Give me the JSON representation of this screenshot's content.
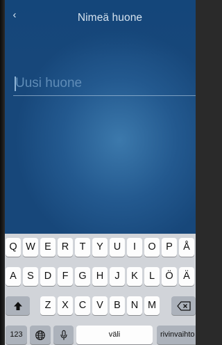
{
  "nav": {
    "back_icon": "chevron-left-icon",
    "back_glyph": "‹",
    "title": "Nimeä huone"
  },
  "room_name": {
    "value": "",
    "placeholder": "Uusi huone"
  },
  "keyboard": {
    "row1": [
      "Q",
      "W",
      "E",
      "R",
      "T",
      "Y",
      "U",
      "I",
      "O",
      "P",
      "Å"
    ],
    "row2": [
      "A",
      "S",
      "D",
      "F",
      "G",
      "H",
      "J",
      "K",
      "L",
      "Ö",
      "Ä"
    ],
    "row3": [
      "Z",
      "X",
      "C",
      "V",
      "B",
      "N",
      "M"
    ],
    "shift_icon": "shift-icon",
    "delete_icon": "delete-icon",
    "numbers_label": "123",
    "globe_icon": "globe-icon",
    "mic_icon": "microphone-icon",
    "space_label": "väli",
    "return_label": "rivinvaihto"
  },
  "colors": {
    "background_top": "#14467a",
    "background_glow": "#3c79ac",
    "title_text": "#d6e3ef",
    "placeholder_text": "#5f8cb7",
    "keyboard_bg": "#d1d4d9",
    "key_bg": "#fdfdfd",
    "special_key_bg": "#acb2bb"
  }
}
